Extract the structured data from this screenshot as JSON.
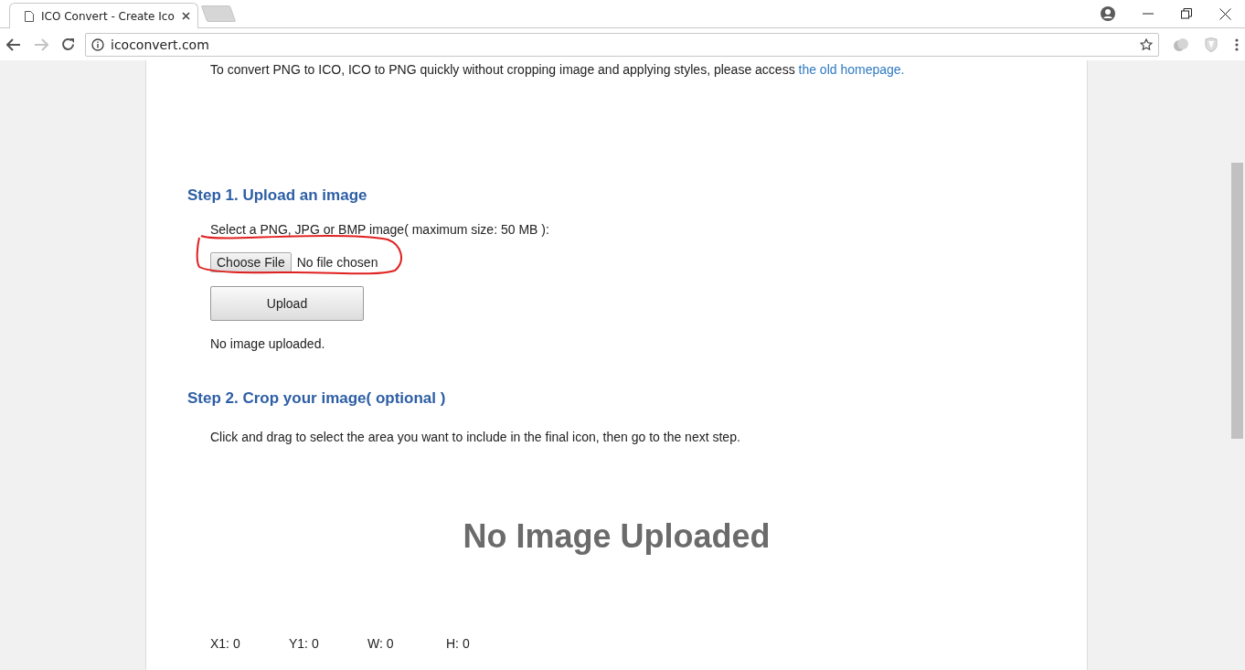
{
  "browser": {
    "tabs": [
      {
        "title": "ICO Convert - Create Ico",
        "selected": true
      }
    ],
    "address": "icoconvert.com"
  },
  "intro": {
    "text": "To convert PNG to ICO, ICO to PNG quickly without cropping image and applying styles, please access ",
    "link": "the old homepage."
  },
  "step1": {
    "heading": "Step 1. Upload an image",
    "instruction": "Select a PNG, JPG or BMP image( maximum size: 50 MB ):",
    "file_button": "Choose File",
    "file_status": "No file chosen",
    "upload_button": "Upload",
    "status": "No image uploaded."
  },
  "step2": {
    "heading": "Step 2. Crop your image( optional )",
    "instruction": "Click and drag to select the area you want to include in the final icon, then go to the next step.",
    "preview_text": "No Image Uploaded",
    "coordinates": [
      {
        "label": "X1: 0"
      },
      {
        "label": "Y1: 0"
      },
      {
        "label": "W: 0"
      },
      {
        "label": "H: 0"
      }
    ]
  }
}
